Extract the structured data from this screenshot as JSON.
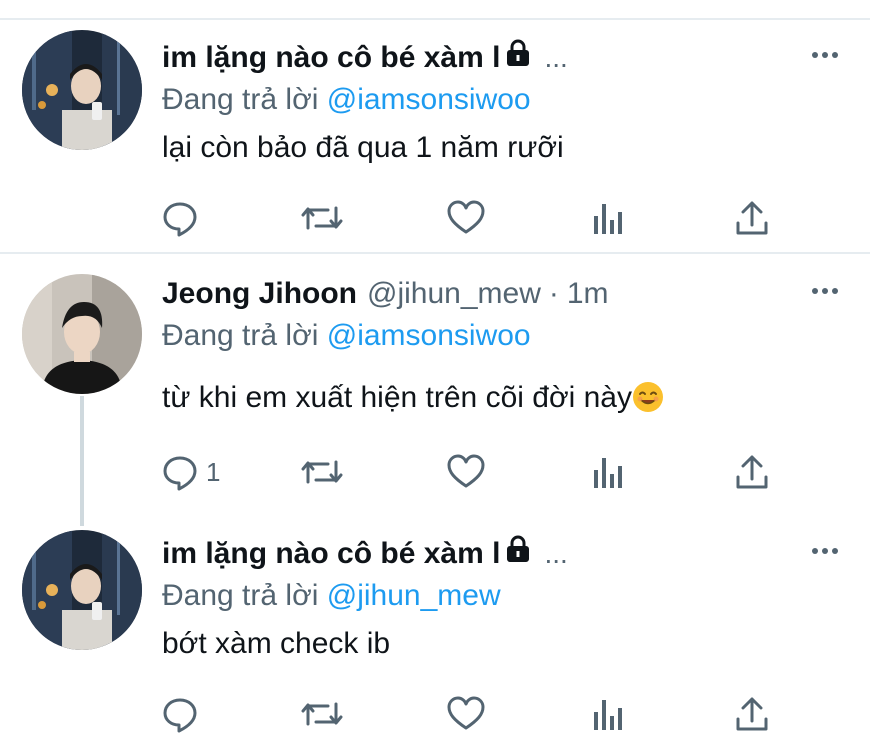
{
  "tweets": [
    {
      "author_name": "im lặng nào cô bé xàm l",
      "locked": true,
      "ellipsis": "...",
      "handle": "",
      "separator": "",
      "time": "",
      "reply_prefix": "Đang trả lời",
      "reply_to": "@iamsonsiwoo",
      "text": "lại còn bảo đã qua 1 năm rưỡi",
      "reply_count": ""
    },
    {
      "author_name": "Jeong Jihoon",
      "locked": false,
      "ellipsis": "",
      "handle": "@jihun_mew",
      "separator": "·",
      "time": "1m",
      "reply_prefix": "Đang trả lời",
      "reply_to": "@iamsonsiwoo",
      "text": "từ khi em xuất hiện trên cõi đời này",
      "emoji": "smiling-face-emoji",
      "reply_count": "1"
    },
    {
      "author_name": "im lặng nào cô bé xàm l",
      "locked": true,
      "ellipsis": "...",
      "handle": "",
      "separator": "",
      "time": "",
      "reply_prefix": "Đang trả lời",
      "reply_to": "@jihun_mew",
      "text": "bớt xàm check ib",
      "reply_count": ""
    }
  ],
  "icons": {
    "reply": "reply-icon",
    "retweet": "retweet-icon",
    "like": "heart-icon",
    "analytics": "analytics-icon",
    "share": "share-icon",
    "more": "more-icon",
    "lock": "lock-icon"
  },
  "colors": {
    "link": "#1d9bf0",
    "secondary_text": "#536471",
    "divider": "#e6ecf0",
    "thread_line": "#cfd9de"
  }
}
